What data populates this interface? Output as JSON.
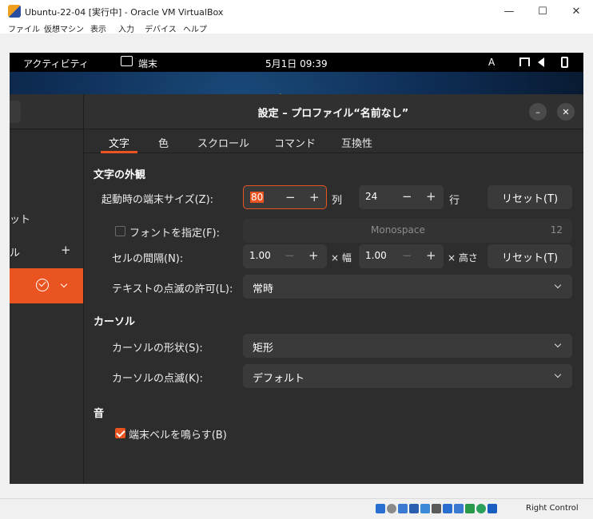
{
  "host": {
    "title": "Ubuntu-22-04 [実行中] - Oracle VM VirtualBox",
    "menu": [
      "ファイル",
      "仮想マシン",
      "表示",
      "入力",
      "デバイス",
      "ヘルプ"
    ],
    "window_controls": {
      "minimize": "—",
      "maximize": "☐",
      "close": "✕"
    },
    "host_key": "Right Control"
  },
  "gnome": {
    "activities": "アクティビティ",
    "app_name": "端末",
    "clock": "5月1日 09:39",
    "input_method": "A"
  },
  "side": {
    "partial_item_1": "ット",
    "partial_item_2": "ル",
    "add_label": "+"
  },
  "dialog": {
    "title": "設定 – プロファイル“名前なし”",
    "minimize_label": "–",
    "close_label": "✕",
    "tabs": [
      "文字",
      "色",
      "スクロール",
      "コマンド",
      "互換性"
    ],
    "text_appearance": {
      "heading": "文字の外観",
      "initial_size_label": "起動時の端末サイズ(Z):",
      "columns_value": "80",
      "columns_unit": "列",
      "rows_value": "24",
      "rows_unit": "行",
      "reset_label": "リセット(T)",
      "custom_font_label": "フォントを指定(F):",
      "font_name": "Monospace",
      "font_size": "12",
      "cell_spacing_label": "セルの間隔(N):",
      "width_value": "1.00",
      "width_unit": "× 幅",
      "height_value": "1.00",
      "height_unit": "× 高さ",
      "reset2_label": "リセット(T)",
      "blink_label": "テキストの点滅の許可(L):",
      "blink_value": "常時"
    },
    "cursor": {
      "heading": "カーソル",
      "shape_label": "カーソルの形状(S):",
      "shape_value": "矩形",
      "blink_label": "カーソルの点滅(K):",
      "blink_value": "デフォルト"
    },
    "sound": {
      "heading": "音",
      "bell_label": "端末ベルを鳴らす(B)",
      "bell_checked": true
    },
    "minus": "−",
    "plus": "+"
  },
  "colors": {
    "accent": "#e95420",
    "dialog_bg": "#2d2d2d",
    "field_bg": "#3a3a3a"
  }
}
